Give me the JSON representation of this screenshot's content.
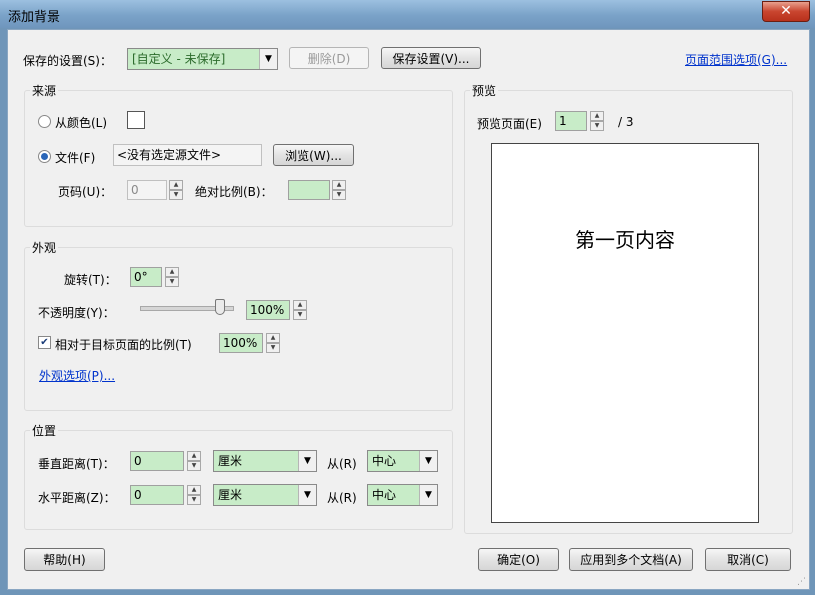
{
  "window": {
    "title": "添加背景",
    "close_glyph": "✕"
  },
  "saved_settings": {
    "label": "保存的设置(S)：",
    "value": "[自定义 - 未保存]",
    "delete_label": "删除(D)",
    "save_label": "保存设置(V)...",
    "page_range_link": "页面范围选项(G)..."
  },
  "source": {
    "title": "来源",
    "from_color_label": "从颜色(L)",
    "file_label": "文件(F)",
    "file_value": "<没有选定源文件>",
    "browse_label": "浏览(W)...",
    "page_number_label": "页码(U)：",
    "page_number_value": "0",
    "absolute_scale_label": "绝对比例(B)："
  },
  "appearance": {
    "title": "外观",
    "rotation_label": "旋转(T)：",
    "rotation_value": "0°",
    "opacity_label": "不透明度(Y)：",
    "opacity_value": "100%",
    "relative_scale_label": "相对于目标页面的比例(T)",
    "relative_scale_value": "100%",
    "options_link": "外观选项(P)..."
  },
  "position": {
    "title": "位置",
    "vertical_label": "垂直距离(T)：",
    "vertical_value": "0",
    "vertical_unit": "厘米",
    "vertical_from_label": "从(R)",
    "vertical_from_value": "中心",
    "horizontal_label": "水平距离(Z)：",
    "horizontal_value": "0",
    "horizontal_unit": "厘米",
    "horizontal_from_label": "从(R)",
    "horizontal_from_value": "中心"
  },
  "preview": {
    "title": "预览",
    "page_label": "预览页面(E)",
    "page_value": "1",
    "page_total": "/ 3",
    "page_content": "第一页内容"
  },
  "buttons": {
    "help": "帮助(H)",
    "ok": "确定(O)",
    "apply_multiple": "应用到多个文档(A)",
    "cancel": "取消(C)"
  },
  "state": {
    "from_color_selected": false,
    "file_selected": true,
    "relative_scale_checked": true,
    "opacity_percent": 100
  }
}
